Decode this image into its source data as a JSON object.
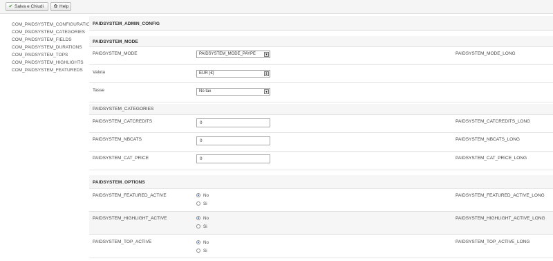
{
  "toolbar": {
    "save_label": "Salva e Chiudi",
    "save_icon": "check-icon",
    "help_label": "Help",
    "help_icon": "gear-icon"
  },
  "sidebar": {
    "items": [
      "COM_PAIDSYSTEM_CONFIGURATION",
      "COM_PAIDSYSTEM_CATEGORIES",
      "COM_PAIDSYSTEM_FIELDS",
      "COM_PAIDSYSTEM_DURATIONS",
      "COM_PAIDSYSTEM_TOPS",
      "COM_PAIDSYSTEM_HIGHLIGHTS",
      "COM_PAIDSYSTEM_FEATUREDS"
    ]
  },
  "config": {
    "title": "PAIDSYSTEM_ADMIN_CONFIG",
    "mode_section": "PAIDSYSTEM_MODE",
    "mode": {
      "label": "PAIDSYSTEM_MODE",
      "value": "PAIDSYSTEM_MODE_PAYPE",
      "long": "PAIDSYSTEM_MODE_LONG"
    },
    "valuta": {
      "label": "Valuta",
      "value": "EUR (€)"
    },
    "tasse": {
      "label": "Tasse",
      "value": "No tax"
    },
    "categories_section": "PAIDSYSTEM_CATEGORIES",
    "catcredits": {
      "label": "PAIDSYSTEM_CATCREDITS",
      "value": "0",
      "long": "PAIDSYSTEM_CATCREDITS_LONG"
    },
    "nbcats": {
      "label": "PAIDSYSTEM_NBCATS",
      "value": "0",
      "long": "PAIDSYSTEM_NBCATS_LONG"
    },
    "cat_price": {
      "label": "PAIDSYSTEM_CAT_PRICE",
      "value": "0",
      "long": "PAIDSYSTEM_CAT_PRICE_LONG"
    },
    "options_section": "PAIDSYSTEM_OPTIONS",
    "featured": {
      "label": "PAIDSYSTEM_FEATURED_ACTIVE",
      "long": "PAIDSYSTEM_FEATURED_ACTIVE_LONG",
      "no": "No",
      "si": "Si",
      "selected": "No"
    },
    "highlight": {
      "label": "PAIDSYSTEM_HIGHLIGHT_ACTIVE",
      "long": "PAIDSYSTEM_HIGHLIGHT_ACTIVE_LONG",
      "no": "No",
      "si": "Si",
      "selected": "No"
    },
    "top": {
      "label": "PAIDSYSTEM_TOP_ACTIVE",
      "long": "PAIDSYSTEM_TOP_ACTIVE_LONG",
      "no": "No",
      "si": "Si",
      "selected": "No"
    }
  }
}
